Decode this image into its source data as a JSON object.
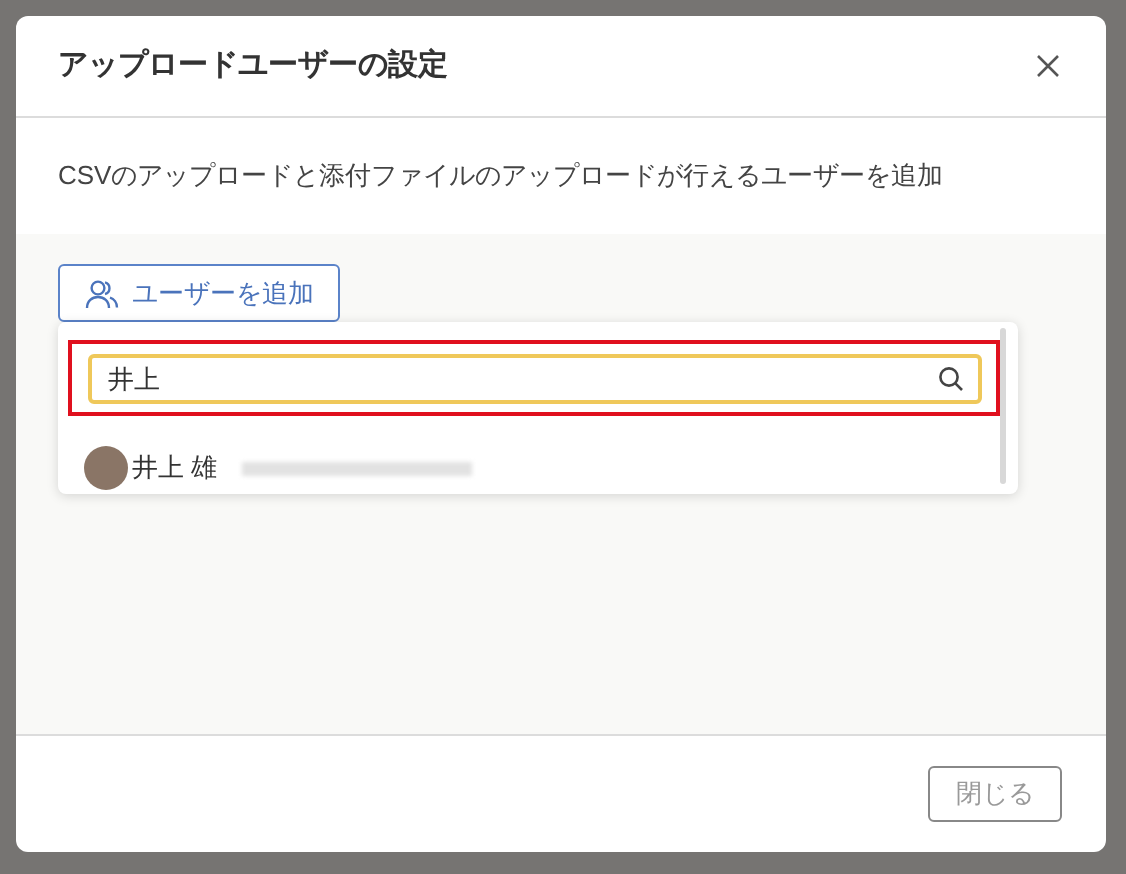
{
  "dialog": {
    "title": "アップロードユーザーの設定",
    "description": "CSVのアップロードと添付ファイルのアップロードが行えるユーザーを追加",
    "add_button": "ユーザーを追加",
    "search": {
      "value": "井上",
      "highlighted": true
    },
    "results": [
      {
        "name": "井上 雄"
      }
    ],
    "close_button": "閉じる"
  }
}
